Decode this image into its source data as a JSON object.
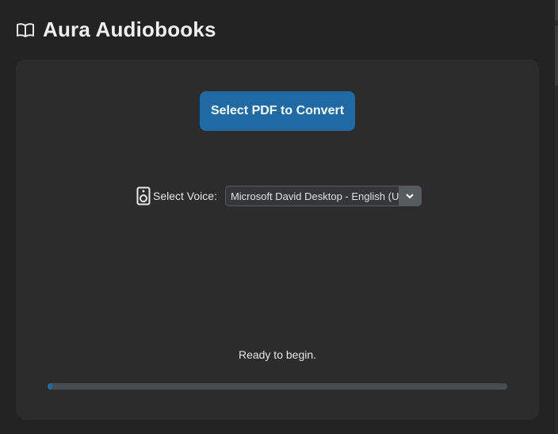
{
  "app": {
    "title": "Aura Audiobooks",
    "icon": "open-book-icon"
  },
  "main": {
    "convert_button_label": "Select PDF to Convert",
    "voice": {
      "label": "Select Voice:",
      "selected": "Microsoft David Desktop - English (United States)",
      "icon": "speaker-icon",
      "dropdown_icon": "chevron-down-icon"
    },
    "status": "Ready to begin.",
    "progress": 0.01
  },
  "colors": {
    "accent": "#1f6aa5",
    "background": "#232323",
    "panel": "#2c2c2c"
  }
}
